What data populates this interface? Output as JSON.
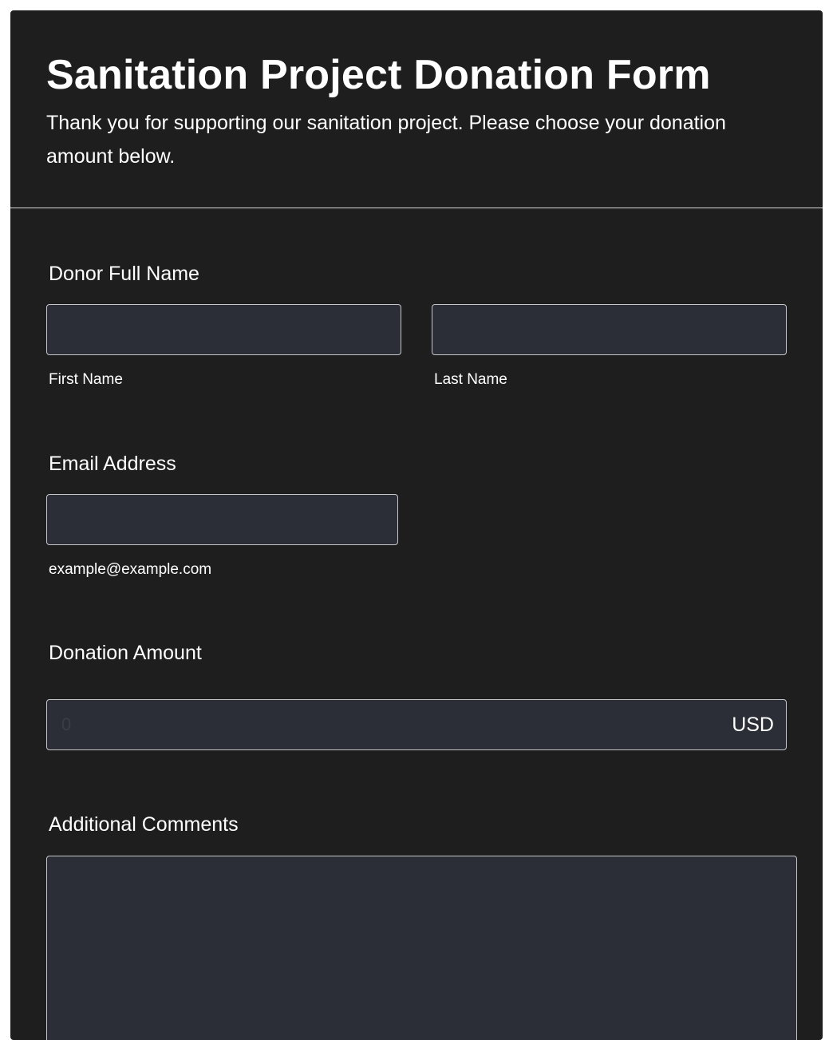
{
  "form": {
    "title": "Sanitation Project Donation Form",
    "subtitle": "Thank you for supporting our sanitation project. Please choose your donation amount below."
  },
  "donor_name": {
    "label": "Donor Full Name",
    "first_name": {
      "value": "",
      "sublabel": "First Name"
    },
    "last_name": {
      "value": "",
      "sublabel": "Last Name"
    }
  },
  "email": {
    "label": "Email Address",
    "value": "",
    "sublabel": "example@example.com"
  },
  "donation": {
    "label": "Donation Amount",
    "value": "0",
    "currency": "USD"
  },
  "comments": {
    "label": "Additional Comments",
    "value": ""
  },
  "colors": {
    "card_background": "#1e1e1f",
    "input_background": "#2b2e37",
    "input_border": "#c5c6c9",
    "text": "#ffffff"
  }
}
